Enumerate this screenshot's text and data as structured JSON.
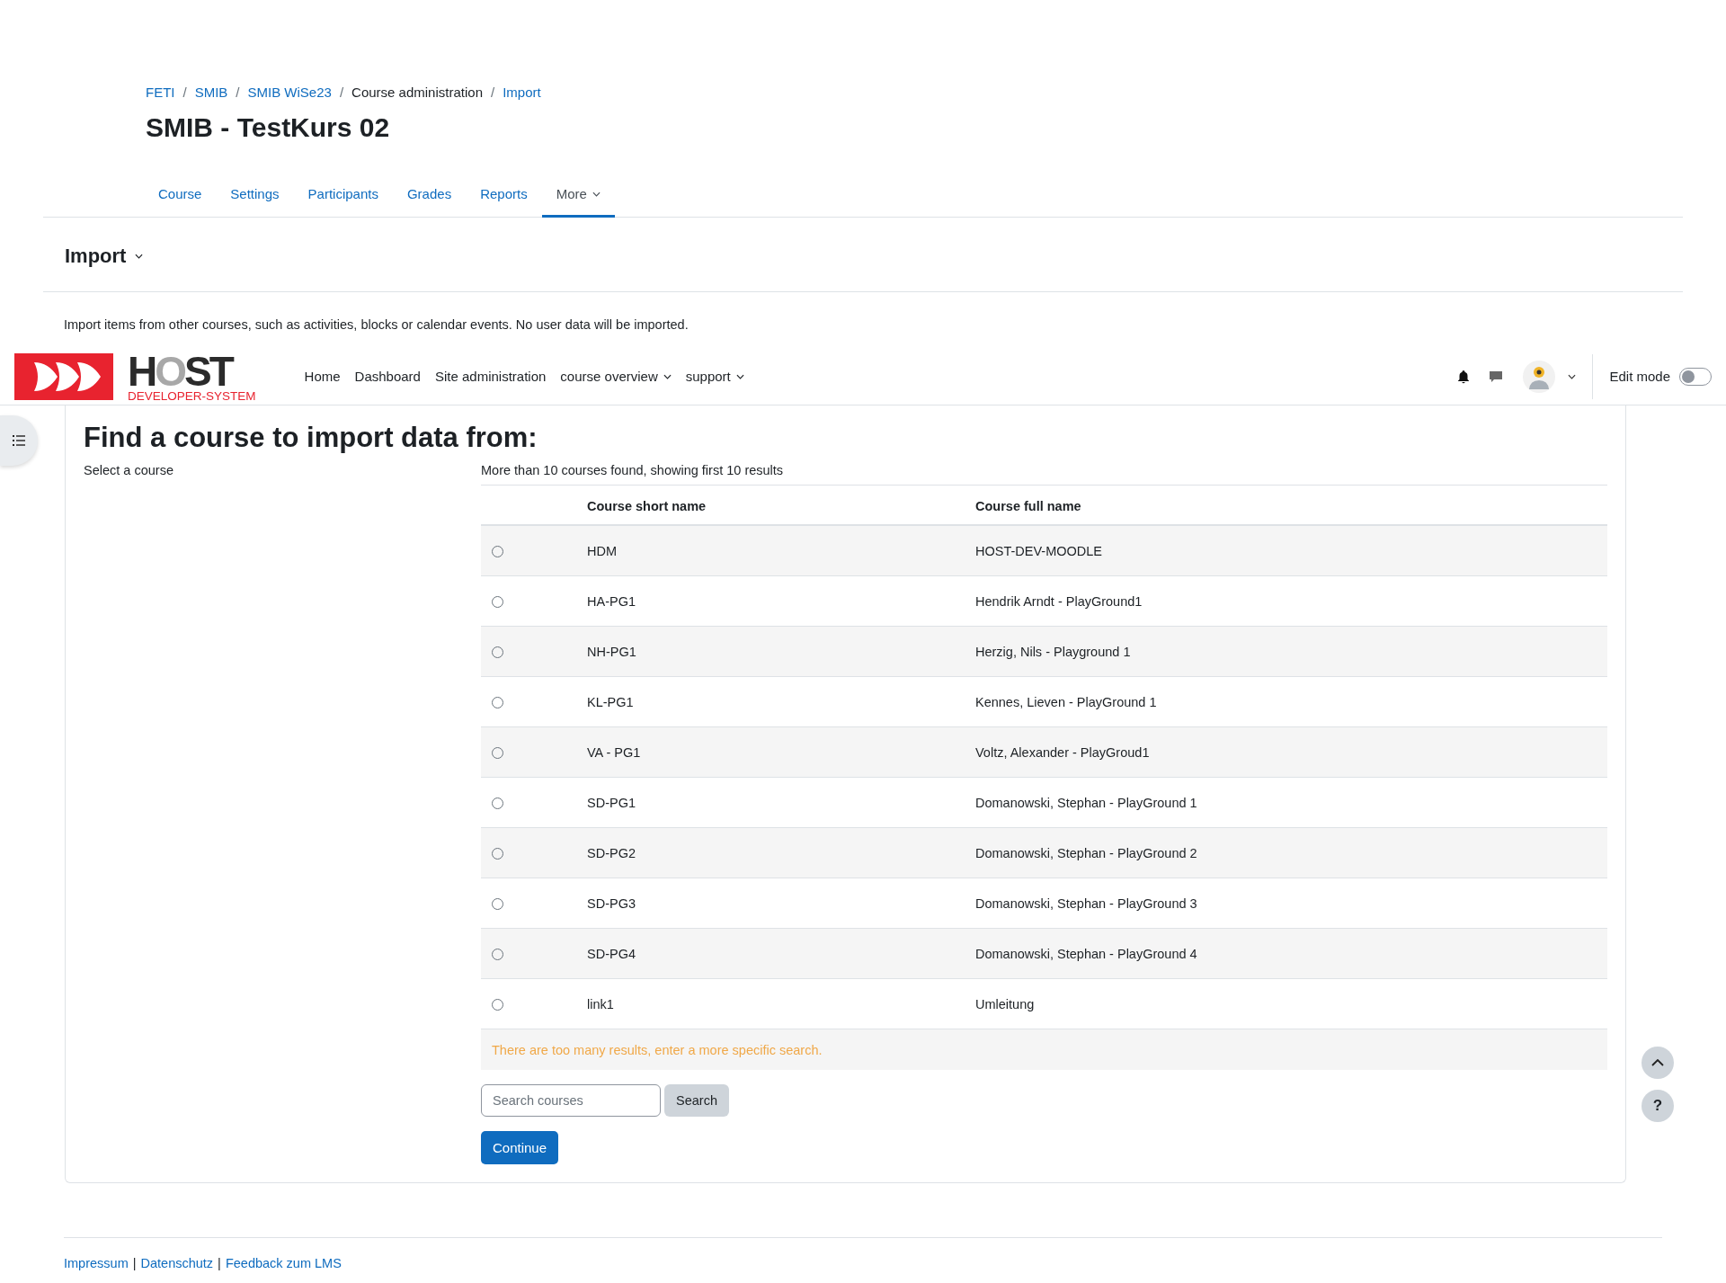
{
  "breadcrumb": [
    {
      "label": "FETI",
      "link": true
    },
    {
      "label": "SMIB",
      "link": true
    },
    {
      "label": "SMIB WiSe23",
      "link": true
    },
    {
      "label": "Course administration",
      "link": false
    },
    {
      "label": "Import",
      "link": true
    }
  ],
  "breadcrumb_separator": "/",
  "page_title": "SMIB - TestKurs 02",
  "tabs": [
    {
      "label": "Course",
      "selected": false,
      "has_menu": false
    },
    {
      "label": "Settings",
      "selected": false,
      "has_menu": false
    },
    {
      "label": "Participants",
      "selected": false,
      "has_menu": false
    },
    {
      "label": "Grades",
      "selected": false,
      "has_menu": false
    },
    {
      "label": "Reports",
      "selected": false,
      "has_menu": false
    },
    {
      "label": "More",
      "selected": true,
      "has_menu": true
    }
  ],
  "section_heading": "Import",
  "intro": "Import items from other courses, such as activities, blocks or calendar events. No user data will be imported.",
  "navbar": {
    "logo": {
      "name": "HOST",
      "tagline": "DEVELOPER-SYSTEM"
    },
    "menu": [
      {
        "label": "Home",
        "has_menu": false
      },
      {
        "label": "Dashboard",
        "has_menu": false
      },
      {
        "label": "Site administration",
        "has_menu": false
      },
      {
        "label": "course overview",
        "has_menu": true
      },
      {
        "label": "support",
        "has_menu": true
      }
    ],
    "edit_mode": {
      "label": "Edit mode",
      "on": false
    }
  },
  "main": {
    "heading": "Find a course to import data from:",
    "select_label": "Select a course",
    "result_note": "More than 10 courses found, showing first 10 results",
    "table": {
      "columns": [
        "Course short name",
        "Course full name"
      ],
      "rows": [
        {
          "short": "HDM",
          "full": "HOST-DEV-MOODLE",
          "selected": false
        },
        {
          "short": "HA-PG1",
          "full": "Hendrik Arndt - PlayGround1",
          "selected": false
        },
        {
          "short": "NH-PG1",
          "full": "Herzig, Nils - Playground 1",
          "selected": false
        },
        {
          "short": "KL-PG1",
          "full": "Kennes, Lieven - PlayGround 1",
          "selected": false
        },
        {
          "short": "VA - PG1",
          "full": "Voltz, Alexander - PlayGroud1",
          "selected": false
        },
        {
          "short": "SD-PG1",
          "full": "Domanowski, Stephan - PlayGround 1",
          "selected": false
        },
        {
          "short": "SD-PG2",
          "full": "Domanowski, Stephan - PlayGround 2",
          "selected": false
        },
        {
          "short": "SD-PG3",
          "full": "Domanowski, Stephan - PlayGround 3",
          "selected": false
        },
        {
          "short": "SD-PG4",
          "full": "Domanowski, Stephan - PlayGround 4",
          "selected": false
        },
        {
          "short": "link1",
          "full": "Umleitung",
          "selected": false
        }
      ],
      "warning": "There are too many results, enter a more specific search."
    },
    "search": {
      "placeholder": "Search courses",
      "button": "Search"
    },
    "continue_button": "Continue"
  },
  "help_button": "?",
  "footer": {
    "links": [
      "Impressum",
      "Datenschutz",
      "Feedback zum LMS"
    ],
    "separator": "|"
  }
}
